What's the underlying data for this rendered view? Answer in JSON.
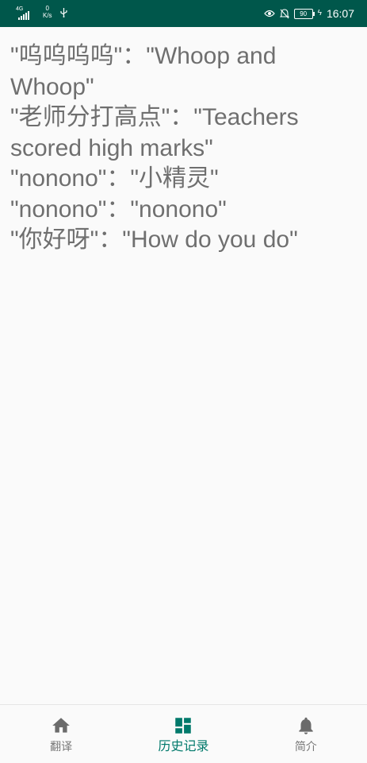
{
  "status_bar": {
    "network_type": "4G",
    "speed_value": "0",
    "speed_unit": "K/s",
    "battery_level": "90",
    "time": "16:07",
    "background_color": "#00574b",
    "icons": [
      "signal-icon",
      "usb-icon",
      "eye-comfort-icon",
      "mute-bell-icon",
      "battery-icon",
      "charging-icon"
    ]
  },
  "history": {
    "entries": [
      "\"呜呜呜呜\"：\"Whoop and Whoop\"",
      "\"老师分打高点\"：\"Teachers scored high marks\"",
      "\"nonono\"：\"小精灵\"",
      "\"nonono\"：\"nonono\"",
      "\"你好呀\"：\"How do you do\""
    ]
  },
  "bottom_nav": {
    "active_color": "#00796b",
    "items": [
      {
        "label": "翻译",
        "icon": "home-icon",
        "active": false
      },
      {
        "label": "历史记录",
        "icon": "dashboard-icon",
        "active": true
      },
      {
        "label": "简介",
        "icon": "bell-icon",
        "active": false
      }
    ]
  }
}
